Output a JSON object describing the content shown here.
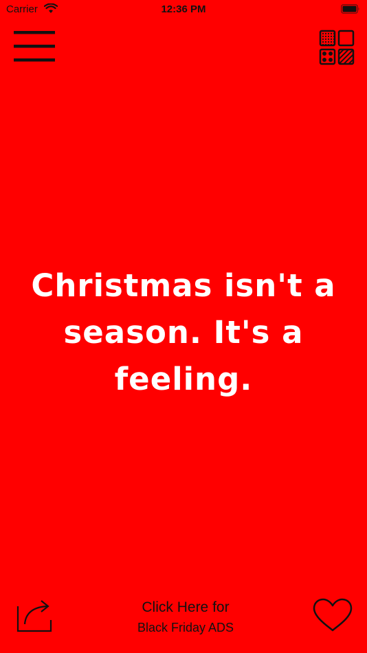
{
  "status_bar": {
    "carrier": "Carrier",
    "time": "12:36 PM",
    "wifi_icon": "wifi-icon",
    "battery_icon": "battery-icon"
  },
  "toolbar": {
    "menu_icon": "hamburger-menu-icon",
    "theme_icon": "background-pattern-grid-icon"
  },
  "quote": {
    "text": "Christmas isn't a season. It's a feeling."
  },
  "bottom_bar": {
    "share_icon": "share-export-icon",
    "promo_line1": "Click Here for",
    "promo_line2": "Black Friday ADS",
    "favorite_icon": "heart-icon"
  },
  "colors": {
    "background": "#ff0000",
    "quote_text": "#ffffff",
    "icons": "#111111"
  }
}
